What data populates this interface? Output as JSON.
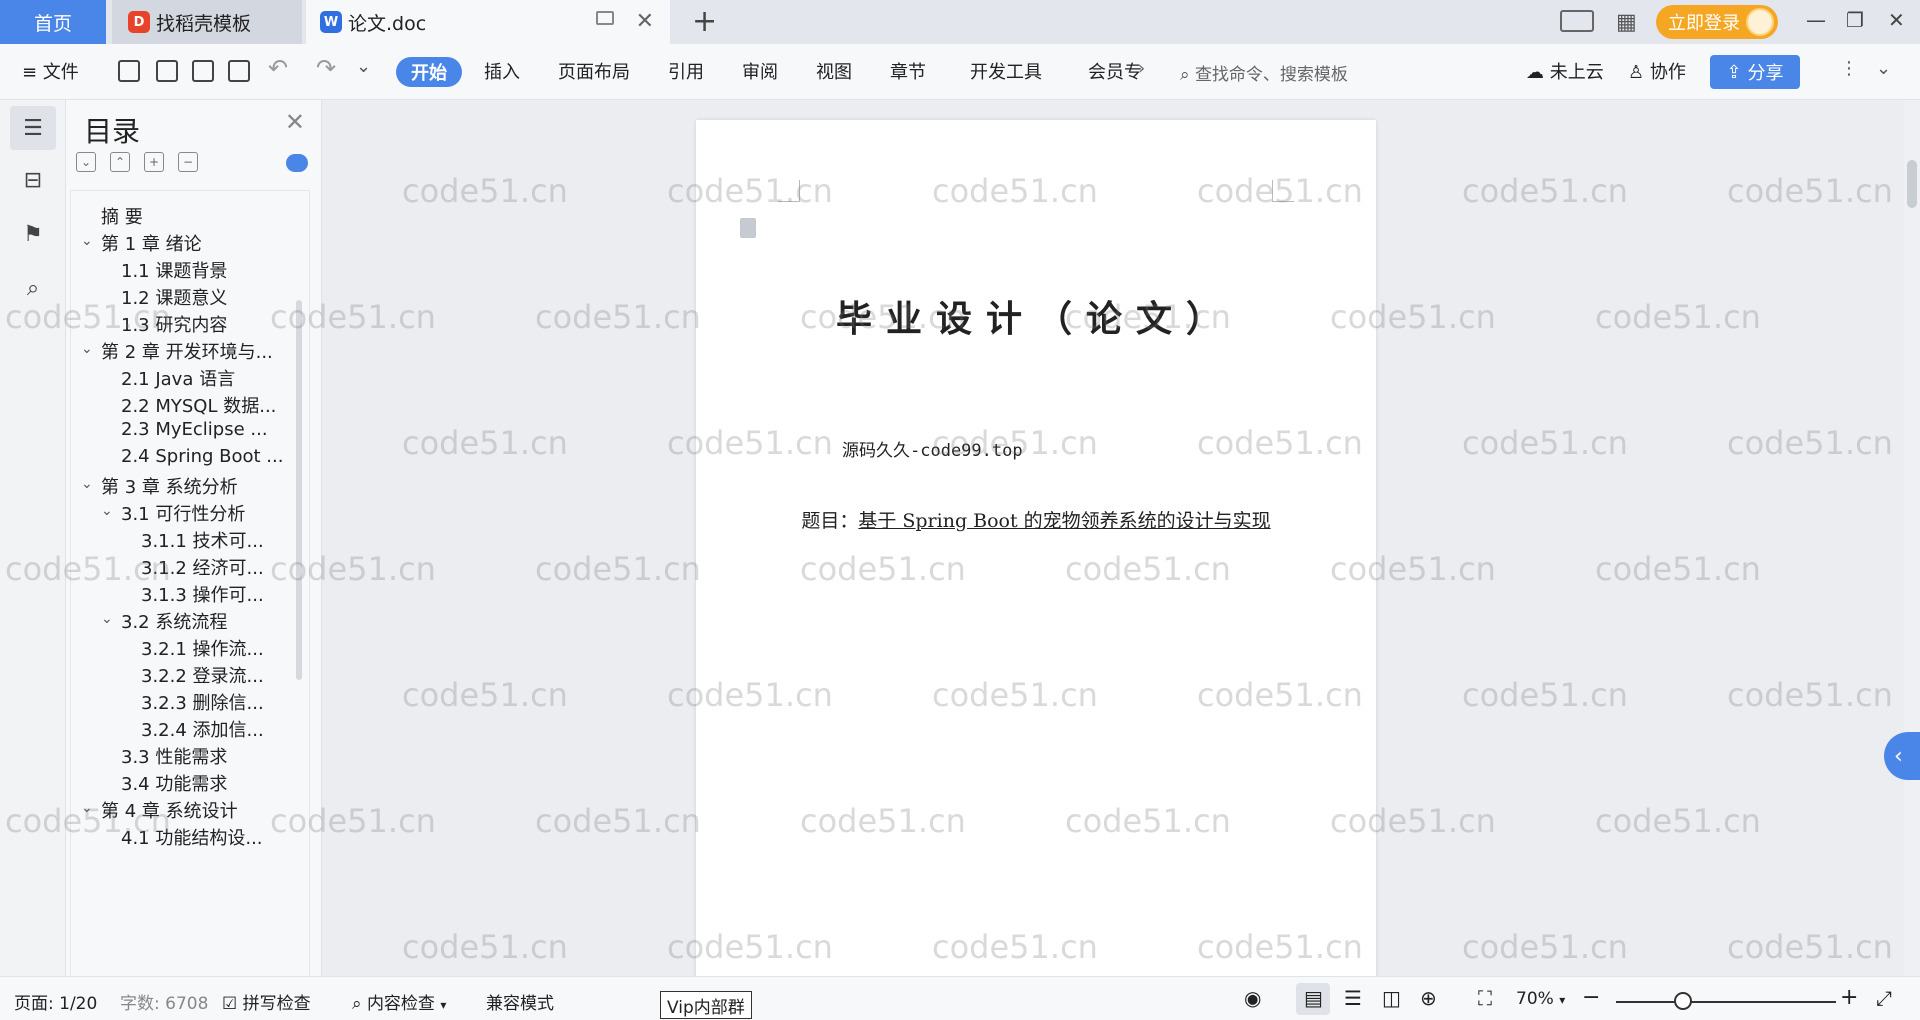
{
  "tabs": {
    "home": "首页",
    "daoke": "找稻壳模板",
    "doc": "论文.doc",
    "add": "+"
  },
  "header": {
    "login": "立即登录",
    "win_min": "—",
    "win_max": "❐",
    "win_close": "✕"
  },
  "ribbon": {
    "menu": "≡ 文件",
    "tabs": [
      "开始",
      "插入",
      "页面布局",
      "引用",
      "审阅",
      "视图",
      "章节",
      "开发工具",
      "会员专"
    ],
    "search_placeholder": "查找命令、搜索模板",
    "cloud": "未上云",
    "collab": "协作",
    "share": "分享"
  },
  "toc": {
    "title": "目录",
    "items": [
      {
        "label": "摘    要"
      },
      {
        "label": "第 1 章  绪论"
      },
      {
        "label": "1.1  课题背景"
      },
      {
        "label": "1.2  课题意义"
      },
      {
        "label": "1.3  研究内容"
      },
      {
        "label": "第 2 章  开发环境与..."
      },
      {
        "label": "2.1 Java 语言"
      },
      {
        "label": "2.2 MYSQL 数据..."
      },
      {
        "label": "2.3 MyEclipse ..."
      },
      {
        "label": "2.4 Spring Boot ..."
      },
      {
        "label": "第 3 章  系统分析"
      },
      {
        "label": "3.1  可行性分析"
      },
      {
        "label": "3.1.1  技术可..."
      },
      {
        "label": "3.1.2  经济可..."
      },
      {
        "label": "3.1.3  操作可..."
      },
      {
        "label": "3.2  系统流程"
      },
      {
        "label": "3.2.1  操作流..."
      },
      {
        "label": "3.2.2  登录流..."
      },
      {
        "label": "3.2.3  删除信..."
      },
      {
        "label": "3.2.4  添加信..."
      },
      {
        "label": "3.3  性能需求"
      },
      {
        "label": "3.4  功能需求"
      },
      {
        "label": "第 4 章  系统设计"
      },
      {
        "label": "4.1  功能结构设..."
      }
    ]
  },
  "document": {
    "title": "毕业设计（论文）",
    "source": "源码久久-code99.top",
    "subject_prefix": "题目：",
    "subject": "基于 Spring Boot 的宠物领养系统的设计与实现"
  },
  "watermark": "code51.cn",
  "status": {
    "page": "页面: 1/20",
    "words": "字数: 6708",
    "spell": "拼写检查",
    "content_check": "内容检查",
    "compat": "兼容模式",
    "vip": "Vip内部群",
    "zoom": "70%"
  },
  "colors": {
    "accent": "#4a86e8",
    "login": "#f5a623"
  }
}
